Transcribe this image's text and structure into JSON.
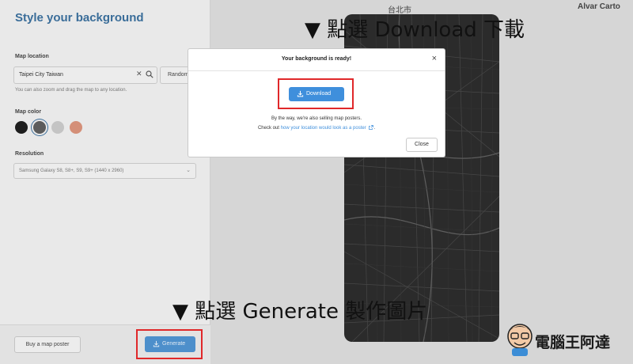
{
  "panel": {
    "title": "Style your background",
    "map_location_label": "Map location",
    "location_value": "Taipei City Taiwan",
    "random_label": "Random",
    "hint": "You can also zoom and drag the map to any location.",
    "map_color_label": "Map color",
    "colors": [
      "#1e1e1e",
      "#5c5c5c",
      "#c4c4c4",
      "#d48f78"
    ],
    "selected_color_index": 1,
    "resolution_label": "Resolution",
    "resolution_value": "Samsung Galaxy S8, S8+, S9, S9+ (1440 x 2960)",
    "buy_label": "Buy a map poster",
    "generate_label": "Generate"
  },
  "preview": {
    "city_label": "台北市",
    "brand": "Alvar Carto"
  },
  "modal": {
    "title": "Your background is ready!",
    "close_symbol": "×",
    "download_label": "Download",
    "line1": "By the way, we're also selling map posters.",
    "line2_prefix": "Check out ",
    "line2_link": "how your location would look as a poster",
    "line2_suffix": ".",
    "close_label": "Close"
  },
  "annotations": {
    "top": "▼ 點選 Download 下載",
    "bottom": "▼ 點選 Generate 製作圖片",
    "watermark": "電腦王阿達"
  },
  "colors": {
    "accent": "#3f8fdc",
    "title_blue": "#3a6d99",
    "highlight_red": "#e0282a"
  }
}
